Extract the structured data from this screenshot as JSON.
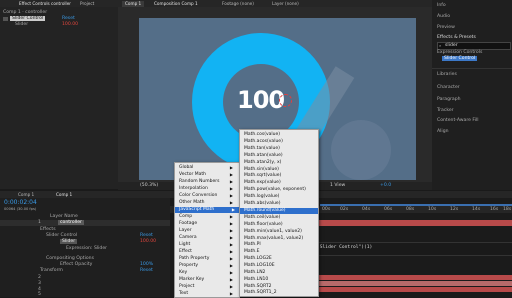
{
  "top_left_tabs": {
    "effect_controls": "Effect Controls controller",
    "project": "Project"
  },
  "effect_controls": {
    "comp_path": "Comp 1 · controller",
    "fx_name": "Slider Control",
    "reset": "Reset",
    "slider_label": "Slider",
    "slider_value": "100.00"
  },
  "viewer_tabs": {
    "comp": "Comp 1",
    "composition": "Composition Comp 1",
    "footage": "Footage (none)",
    "layer": "Layer (none)"
  },
  "viewer": {
    "big_number": "100",
    "zoom": "(50.3%)",
    "view": "1 View",
    "offset": "+0.0"
  },
  "right_panel": {
    "info": "Info",
    "audio": "Audio",
    "preview": "Preview",
    "effects_presets": "Effects & Presets",
    "search_value": "slider",
    "category": "Expression Controls",
    "result": "Slider Control",
    "libraries": "Libraries",
    "character": "Character",
    "paragraph": "Paragraph",
    "tracker": "Tracker",
    "content_aware": "Content-Aware Fill",
    "align": "Align"
  },
  "timeline": {
    "tab_render": "Comp 1",
    "tab_comp": "Comp 1",
    "timecode": "0:00:02:04",
    "fps": "00064 (30.00 fps)",
    "layer_name_header": "Layer Name",
    "layers": [
      {
        "num": "1",
        "name": "controller"
      },
      {
        "label": "Effects"
      },
      {
        "label": "Slider Control",
        "value": "Reset"
      },
      {
        "label": "Slider",
        "value": "100.00"
      },
      {
        "label": "Expression: Slider"
      },
      {
        "label": "Compositing Options"
      },
      {
        "label": "Effect Opacity",
        "value": "100%"
      },
      {
        "label": "Transform",
        "value": "Reset"
      },
      {
        "num": "2"
      },
      {
        "num": "3"
      },
      {
        "num": "4"
      },
      {
        "num": "5"
      }
    ],
    "ruler": [
      "00s",
      "02s",
      "04s",
      "06s",
      "08s",
      "10s",
      "12s",
      "14s",
      "16s",
      "18s"
    ],
    "expression_line": "\"Slider Control\")(1)"
  },
  "context_menu": {
    "items": [
      "Global",
      "Vector Math",
      "Random Numbers",
      "Interpolation",
      "Color Conversion",
      "Other Math",
      "JavaScript Math",
      "Comp",
      "Footage",
      "Layer",
      "Camera",
      "Light",
      "Effect",
      "Path Property",
      "Property",
      "Key",
      "Marker Key",
      "Project",
      "Text"
    ],
    "selected": "JavaScript Math"
  },
  "submenu": {
    "items": [
      "Math.cos(value)",
      "Math.acos(value)",
      "Math.tan(value)",
      "Math.atan(value)",
      "Math.atan2(y, x)",
      "Math.sin(value)",
      "Math.sqrt(value)",
      "Math.exp(value)",
      "Math.pow(value, exponent)",
      "Math.log(value)",
      "Math.abs(value)",
      "Math.round(value)",
      "Math.ceil(value)",
      "Math.floor(value)",
      "Math.min(value1, value2)",
      "Math.max(value1, value2)",
      "Math.PI",
      "Math.E",
      "Math.LOG2E",
      "Math.LOG10E",
      "Math.LN2",
      "Math.LN10",
      "Math.SQRT2",
      "Math.SQRT1_2"
    ],
    "selected": "Math.round(value)"
  },
  "colors": {
    "accent_cyan": "#12b3f3",
    "menu_selection": "#2e6fcc",
    "ui_blue": "#3a9ae6"
  }
}
